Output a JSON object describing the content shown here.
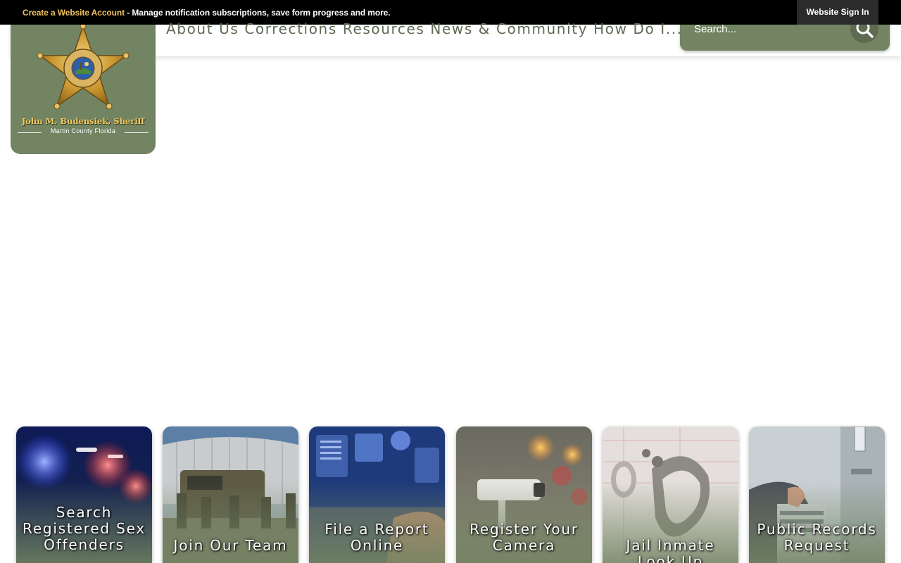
{
  "topbar": {
    "create_account": "Create a Website Account",
    "notice": " - Manage notification subscriptions, save form progress and more.",
    "signin": "Website Sign In"
  },
  "logo": {
    "name": "John M. Budensiek, Sheriff",
    "county": "Martin County Florida"
  },
  "nav": {
    "items": [
      "About Us",
      "Corrections",
      "Resources",
      "News & Community",
      "How Do I..."
    ]
  },
  "search": {
    "placeholder": "Search..."
  },
  "tiles": [
    {
      "label": "Search Registered Sex Offenders"
    },
    {
      "label": "Join Our Team"
    },
    {
      "label": "File a Report Online"
    },
    {
      "label": "Register Your Camera"
    },
    {
      "label": "Jail Inmate Look Up"
    },
    {
      "label": "Public Records Request"
    }
  ],
  "colors": {
    "brand_green": "#728462",
    "nav_text": "#5f6b53",
    "gold": "#f2c35c"
  }
}
